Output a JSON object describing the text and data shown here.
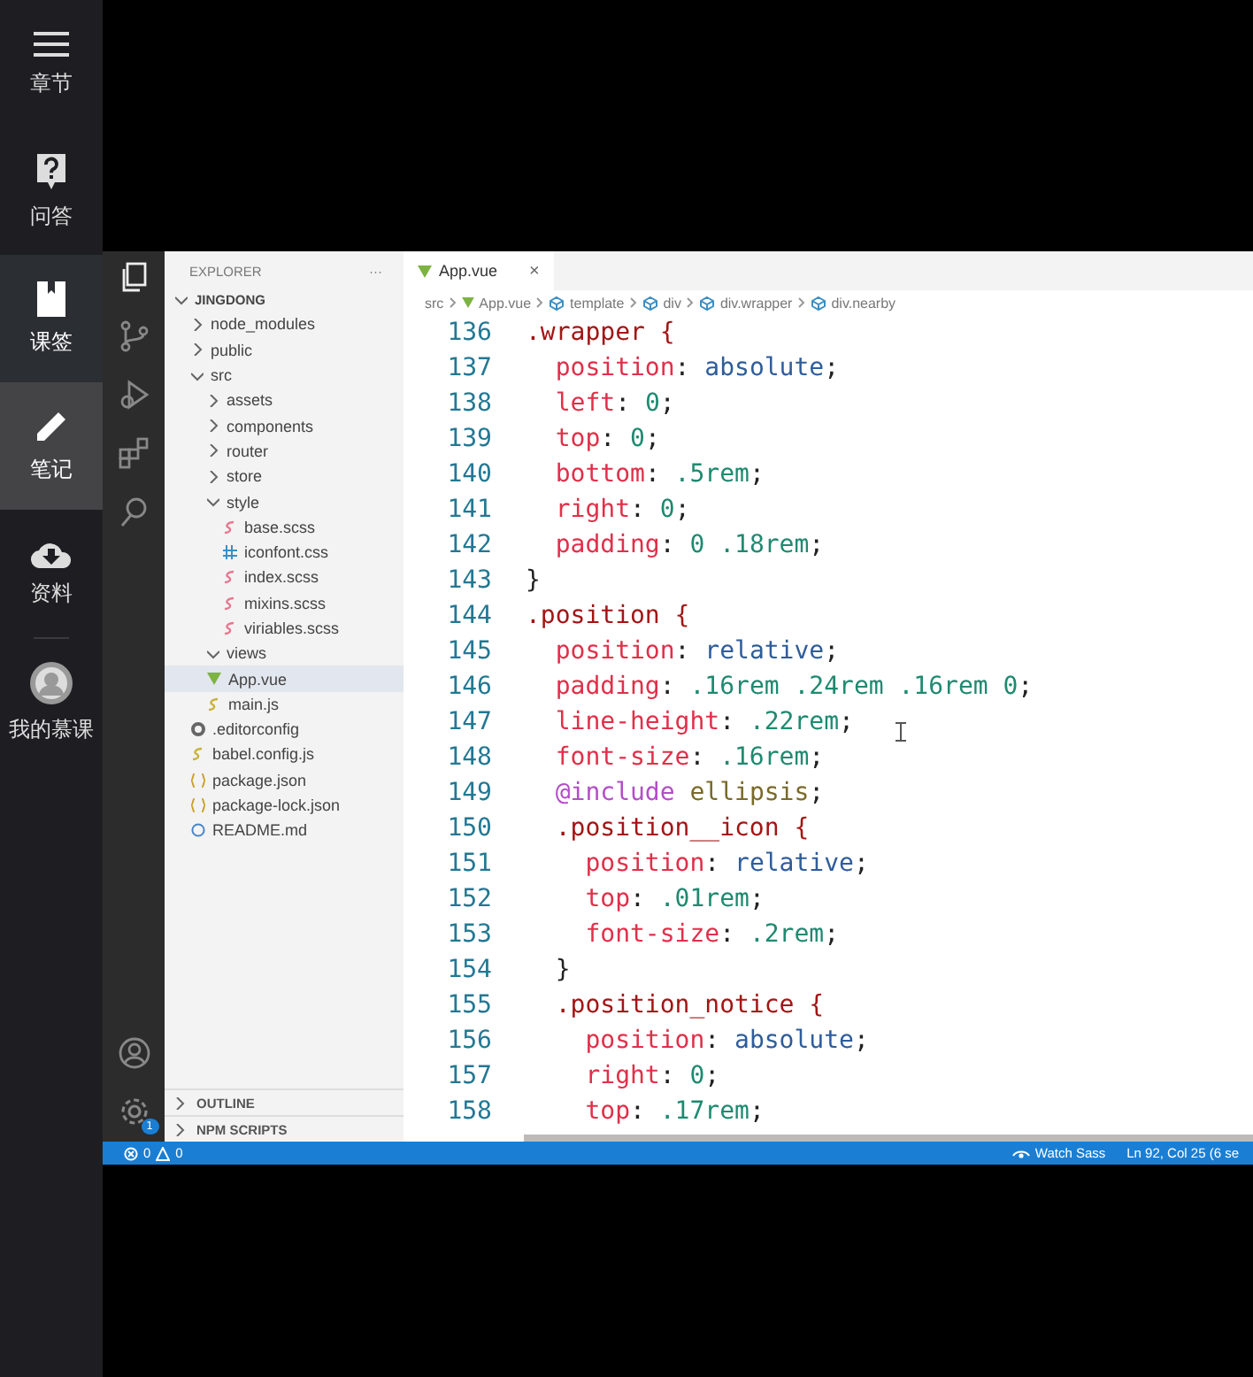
{
  "sidebar": {
    "items": [
      {
        "label": "章节",
        "kind": "menu",
        "selected": false,
        "hovered": false
      },
      {
        "label": "问答",
        "kind": "question",
        "selected": false,
        "hovered": false
      },
      {
        "label": "课签",
        "kind": "bookmark",
        "selected": false,
        "hovered": true
      },
      {
        "label": "笔记",
        "kind": "pencil",
        "selected": true,
        "hovered": false
      },
      {
        "label": "资料",
        "kind": "download",
        "selected": false,
        "hovered": false
      },
      {
        "label": "我的慕课",
        "kind": "avatar",
        "selected": false,
        "hovered": false
      }
    ]
  },
  "editor_window": {
    "activity_bar": {
      "items": [
        {
          "kind": "files",
          "selected": true
        },
        {
          "kind": "branch",
          "selected": false
        },
        {
          "kind": "run",
          "selected": false
        },
        {
          "kind": "extensions",
          "selected": false
        },
        {
          "kind": "search",
          "selected": false
        }
      ],
      "badge": "1"
    },
    "explorer": {
      "title": "EXPLORER",
      "more": "···",
      "tree": [
        {
          "name": "JINGDONG",
          "kind": "root",
          "expanded": true,
          "children": [
            {
              "name": "node_modules",
              "kind": "folder",
              "expanded": false
            },
            {
              "name": "public",
              "kind": "folder",
              "expanded": false
            },
            {
              "name": "src",
              "kind": "folder",
              "expanded": true,
              "children": [
                {
                  "name": "assets",
                  "kind": "folder",
                  "expanded": false
                },
                {
                  "name": "components",
                  "kind": "folder",
                  "expanded": false
                },
                {
                  "name": "router",
                  "kind": "folder",
                  "expanded": false
                },
                {
                  "name": "store",
                  "kind": "folder",
                  "expanded": false
                },
                {
                  "name": "style",
                  "kind": "folder",
                  "expanded": true,
                  "children": [
                    {
                      "name": "base.scss",
                      "kind": "scss"
                    },
                    {
                      "name": "iconfont.css",
                      "kind": "css"
                    },
                    {
                      "name": "index.scss",
                      "kind": "scss"
                    },
                    {
                      "name": "mixins.scss",
                      "kind": "scss"
                    },
                    {
                      "name": "viriables.scss",
                      "kind": "scss"
                    }
                  ]
                },
                {
                  "name": "views",
                  "kind": "folder",
                  "expanded": true
                },
                {
                  "name": "App.vue",
                  "kind": "vue",
                  "selected": true
                },
                {
                  "name": "main.js",
                  "kind": "js"
                }
              ]
            },
            {
              "name": ".editorconfig",
              "kind": "config"
            },
            {
              "name": "babel.config.js",
              "kind": "babel"
            },
            {
              "name": "package.json",
              "kind": "json"
            },
            {
              "name": "package-lock.json",
              "kind": "json"
            },
            {
              "name": "README.md",
              "kind": "info"
            }
          ]
        }
      ],
      "sections": [
        "OUTLINE",
        "NPM SCRIPTS"
      ]
    },
    "tab": {
      "label": "App.vue",
      "close": "×"
    },
    "breadcrumb": [
      "src",
      "App.vue",
      "template",
      "div",
      "div.wrapper",
      "div.nearby"
    ],
    "code": [
      {
        "num": "136",
        "text": ".wrapper {"
      },
      {
        "num": "137",
        "text": "  position: absolute;"
      },
      {
        "num": "138",
        "text": "  left: 0;"
      },
      {
        "num": "139",
        "text": "  top: 0;"
      },
      {
        "num": "140",
        "text": "  bottom: .5rem;"
      },
      {
        "num": "141",
        "text": "  right: 0;"
      },
      {
        "num": "142",
        "text": "  padding: 0 .18rem;"
      },
      {
        "num": "143",
        "text": "}"
      },
      {
        "num": "144",
        "text": ".position {"
      },
      {
        "num": "145",
        "text": "  position: relative;"
      },
      {
        "num": "146",
        "text": "  padding: .16rem .24rem .16rem 0;"
      },
      {
        "num": "147",
        "text": "  line-height: .22rem;"
      },
      {
        "num": "148",
        "text": "  font-size: .16rem;"
      },
      {
        "num": "149",
        "text": "  @include ellipsis;"
      },
      {
        "num": "150",
        "text": "  .position__icon {"
      },
      {
        "num": "151",
        "text": "    position: relative;"
      },
      {
        "num": "152",
        "text": "    top: .01rem;"
      },
      {
        "num": "153",
        "text": "    font-size: .2rem;"
      },
      {
        "num": "154",
        "text": "  }"
      },
      {
        "num": "155",
        "text": "  .position_notice {"
      },
      {
        "num": "156",
        "text": "    position: absolute;"
      },
      {
        "num": "157",
        "text": "    right: 0;"
      },
      {
        "num": "158",
        "text": "    top: .17rem;"
      }
    ],
    "status_bar": {
      "errors": "0",
      "warnings": "0",
      "watch": "Watch Sass",
      "position": "Ln 92, Col 25 (6 se"
    }
  }
}
